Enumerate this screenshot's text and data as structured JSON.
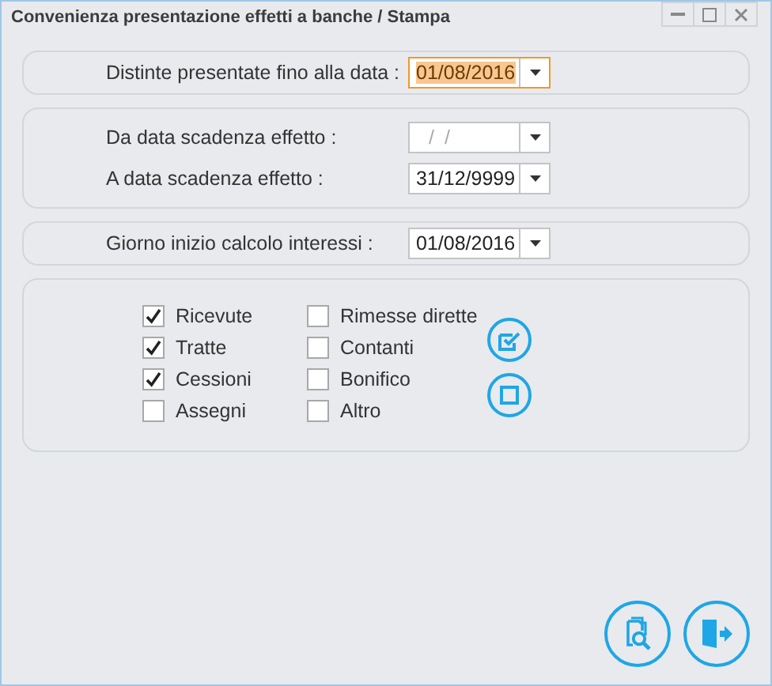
{
  "window": {
    "title": "Convenienza presentazione effetti a banche / Stampa"
  },
  "date_panels": [
    {
      "fields": [
        {
          "label": "Distinte presentate fino alla data :",
          "value": "01/08/2016",
          "focused": true
        }
      ]
    },
    {
      "fields": [
        {
          "label": "Da data scadenza effetto :",
          "placeholder": "/ /",
          "focused": false
        },
        {
          "label": "A data scadenza effetto :",
          "value": "31/12/9999",
          "focused": false
        }
      ]
    },
    {
      "fields": [
        {
          "label": "Giorno inizio calcolo interessi :",
          "value": "01/08/2016",
          "focused": false
        }
      ]
    }
  ],
  "checkbox_groups": [
    {
      "items": [
        {
          "label": "Ricevute",
          "checked": true
        },
        {
          "label": "Tratte",
          "checked": true
        },
        {
          "label": "Cessioni",
          "checked": true
        },
        {
          "label": "Assegni",
          "checked": false
        }
      ]
    },
    {
      "items": [
        {
          "label": "Rimesse dirette",
          "checked": false
        },
        {
          "label": "Contanti",
          "checked": false
        },
        {
          "label": "Bonifico",
          "checked": false
        },
        {
          "label": "Altro",
          "checked": false
        }
      ]
    }
  ],
  "selection_buttons": [
    {
      "kind": "select_all"
    },
    {
      "kind": "deselect_all"
    }
  ],
  "actions": [
    {
      "kind": "preview"
    },
    {
      "kind": "exit"
    }
  ]
}
